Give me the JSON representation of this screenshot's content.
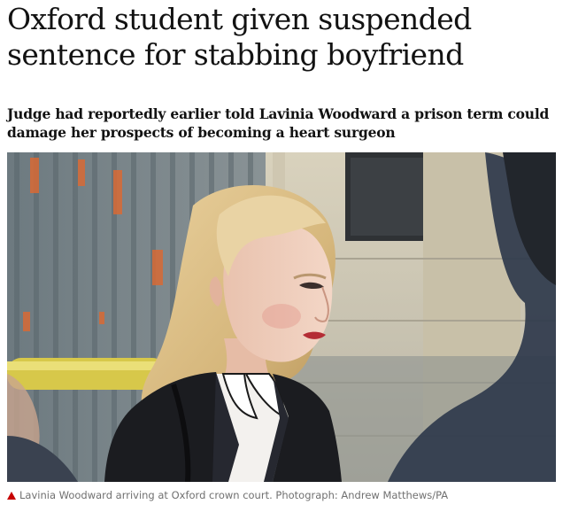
{
  "article": {
    "headline": "Oxford student given suspended sentence for stabbing boyfriend",
    "standfirst": "Judge had reportedly earlier told Lavinia Woodward a prison term could damage her prospects of becoming a heart surgeon",
    "image": {
      "alt": "Lavinia Woodward arriving at Oxford crown court",
      "caption": "Lavinia Woodward arriving at Oxford crown court. Photograph: Andrew Matthews/PA",
      "caption_icon": "triangle-up-icon"
    }
  },
  "colors": {
    "caption_icon": "#c70000",
    "caption_text": "#707070",
    "headline_text": "#121212"
  }
}
